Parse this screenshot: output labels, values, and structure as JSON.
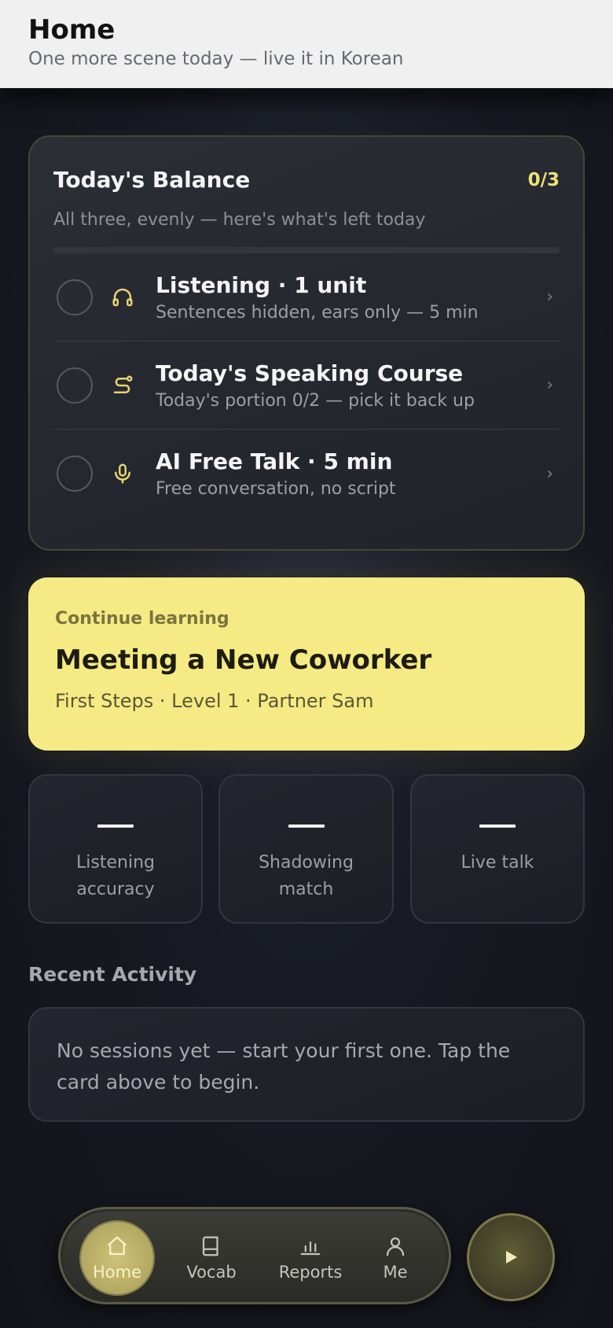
{
  "header": {
    "title": "Home",
    "subtitle": "One more scene today — live it in Korean"
  },
  "balance": {
    "title": "Today's Balance",
    "count": "0/3",
    "subtitle": "All three, evenly — here's what's left today",
    "progress_fraction": 0,
    "tasks": [
      {
        "title": "Listening · 1 unit",
        "subtitle": "Sentences hidden, ears only — 5 min",
        "icon": "headphones-icon",
        "done": false
      },
      {
        "title": "Today's Speaking Course",
        "subtitle": "Today's portion 0/2 — pick it back up",
        "icon": "route-icon",
        "done": false
      },
      {
        "title": "AI Free Talk · 5 min",
        "subtitle": "Free conversation, no script",
        "icon": "microphone-icon",
        "done": false
      }
    ],
    "chevron": "›"
  },
  "continue": {
    "label": "Continue learning",
    "title": "Meeting a New Coworker",
    "meta": "First Steps · Level 1 · Partner Sam"
  },
  "stats": [
    {
      "label": "Listening accuracy"
    },
    {
      "label": "Shadowing match"
    },
    {
      "label": "Live talk"
    }
  ],
  "recent": {
    "title": "Recent Activity",
    "empty_text": "No sessions yet — start your first one. Tap the card above to begin."
  },
  "nav": {
    "items": [
      {
        "label": "Home",
        "icon": "home-icon",
        "active": true
      },
      {
        "label": "Vocab",
        "icon": "book-icon",
        "active": false
      },
      {
        "label": "Reports",
        "icon": "bar-chart-icon",
        "active": false
      },
      {
        "label": "Me",
        "icon": "person-icon",
        "active": false
      }
    ],
    "play_icon": "play-icon"
  },
  "colors": {
    "accent": "#f6ea84",
    "accent_text": "#efe07a",
    "background": "#171a22"
  }
}
